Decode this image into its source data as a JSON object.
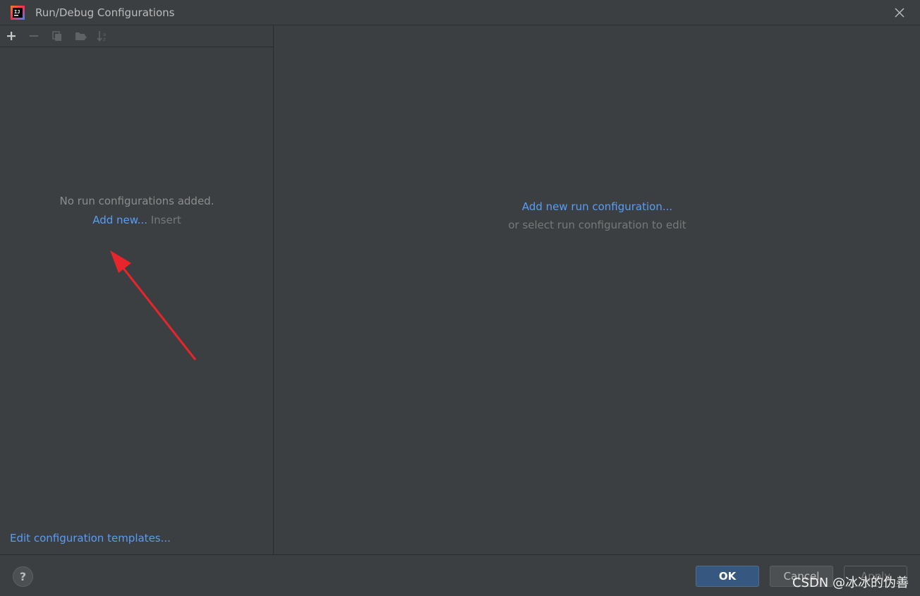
{
  "window": {
    "title": "Run/Debug Configurations"
  },
  "toolbar": {
    "add_icon": "plus-icon",
    "remove_icon": "minus-icon",
    "copy_icon": "copy-icon",
    "folder_icon": "new-folder-icon",
    "sort_icon": "sort-alpha-icon"
  },
  "left_pane": {
    "empty_message": "No run configurations added.",
    "add_new_link": "Add new...",
    "add_new_shortcut": "Insert",
    "templates_link": "Edit configuration templates..."
  },
  "right_pane": {
    "add_link": "Add new run configuration...",
    "hint": "or select run configuration to edit"
  },
  "footer": {
    "help_label": "?",
    "ok_label": "OK",
    "cancel_label": "Cancel",
    "apply_label": "Apply"
  },
  "watermark": "CSDN @冰冰的伪善",
  "colors": {
    "background": "#3c3f41",
    "link": "#589df6",
    "ok_button": "#365880",
    "annotation_arrow": "#e8252b"
  }
}
